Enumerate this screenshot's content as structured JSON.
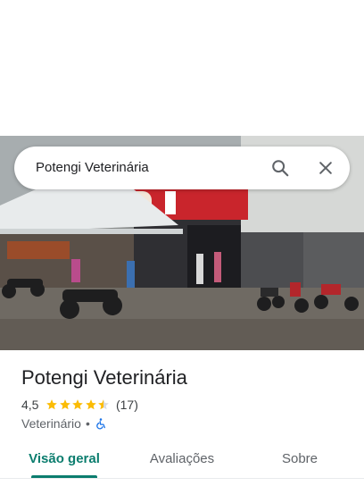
{
  "search": {
    "query": "Potengi Veterinária"
  },
  "place": {
    "name": "Potengi Veterinária",
    "rating": "4,5",
    "rating_value": 4.5,
    "review_count": "(17)",
    "category": "Veterinário",
    "separator": "•",
    "star_color": "#fbbc04",
    "accessibility_icon": "wheelchair-icon"
  },
  "tabs": [
    {
      "label": "Visão geral",
      "active": true
    },
    {
      "label": "Avaliações",
      "active": false
    },
    {
      "label": "Sobre",
      "active": false
    }
  ],
  "colors": {
    "accent": "#0b7d6e",
    "accessibility": "#1a73e8"
  }
}
